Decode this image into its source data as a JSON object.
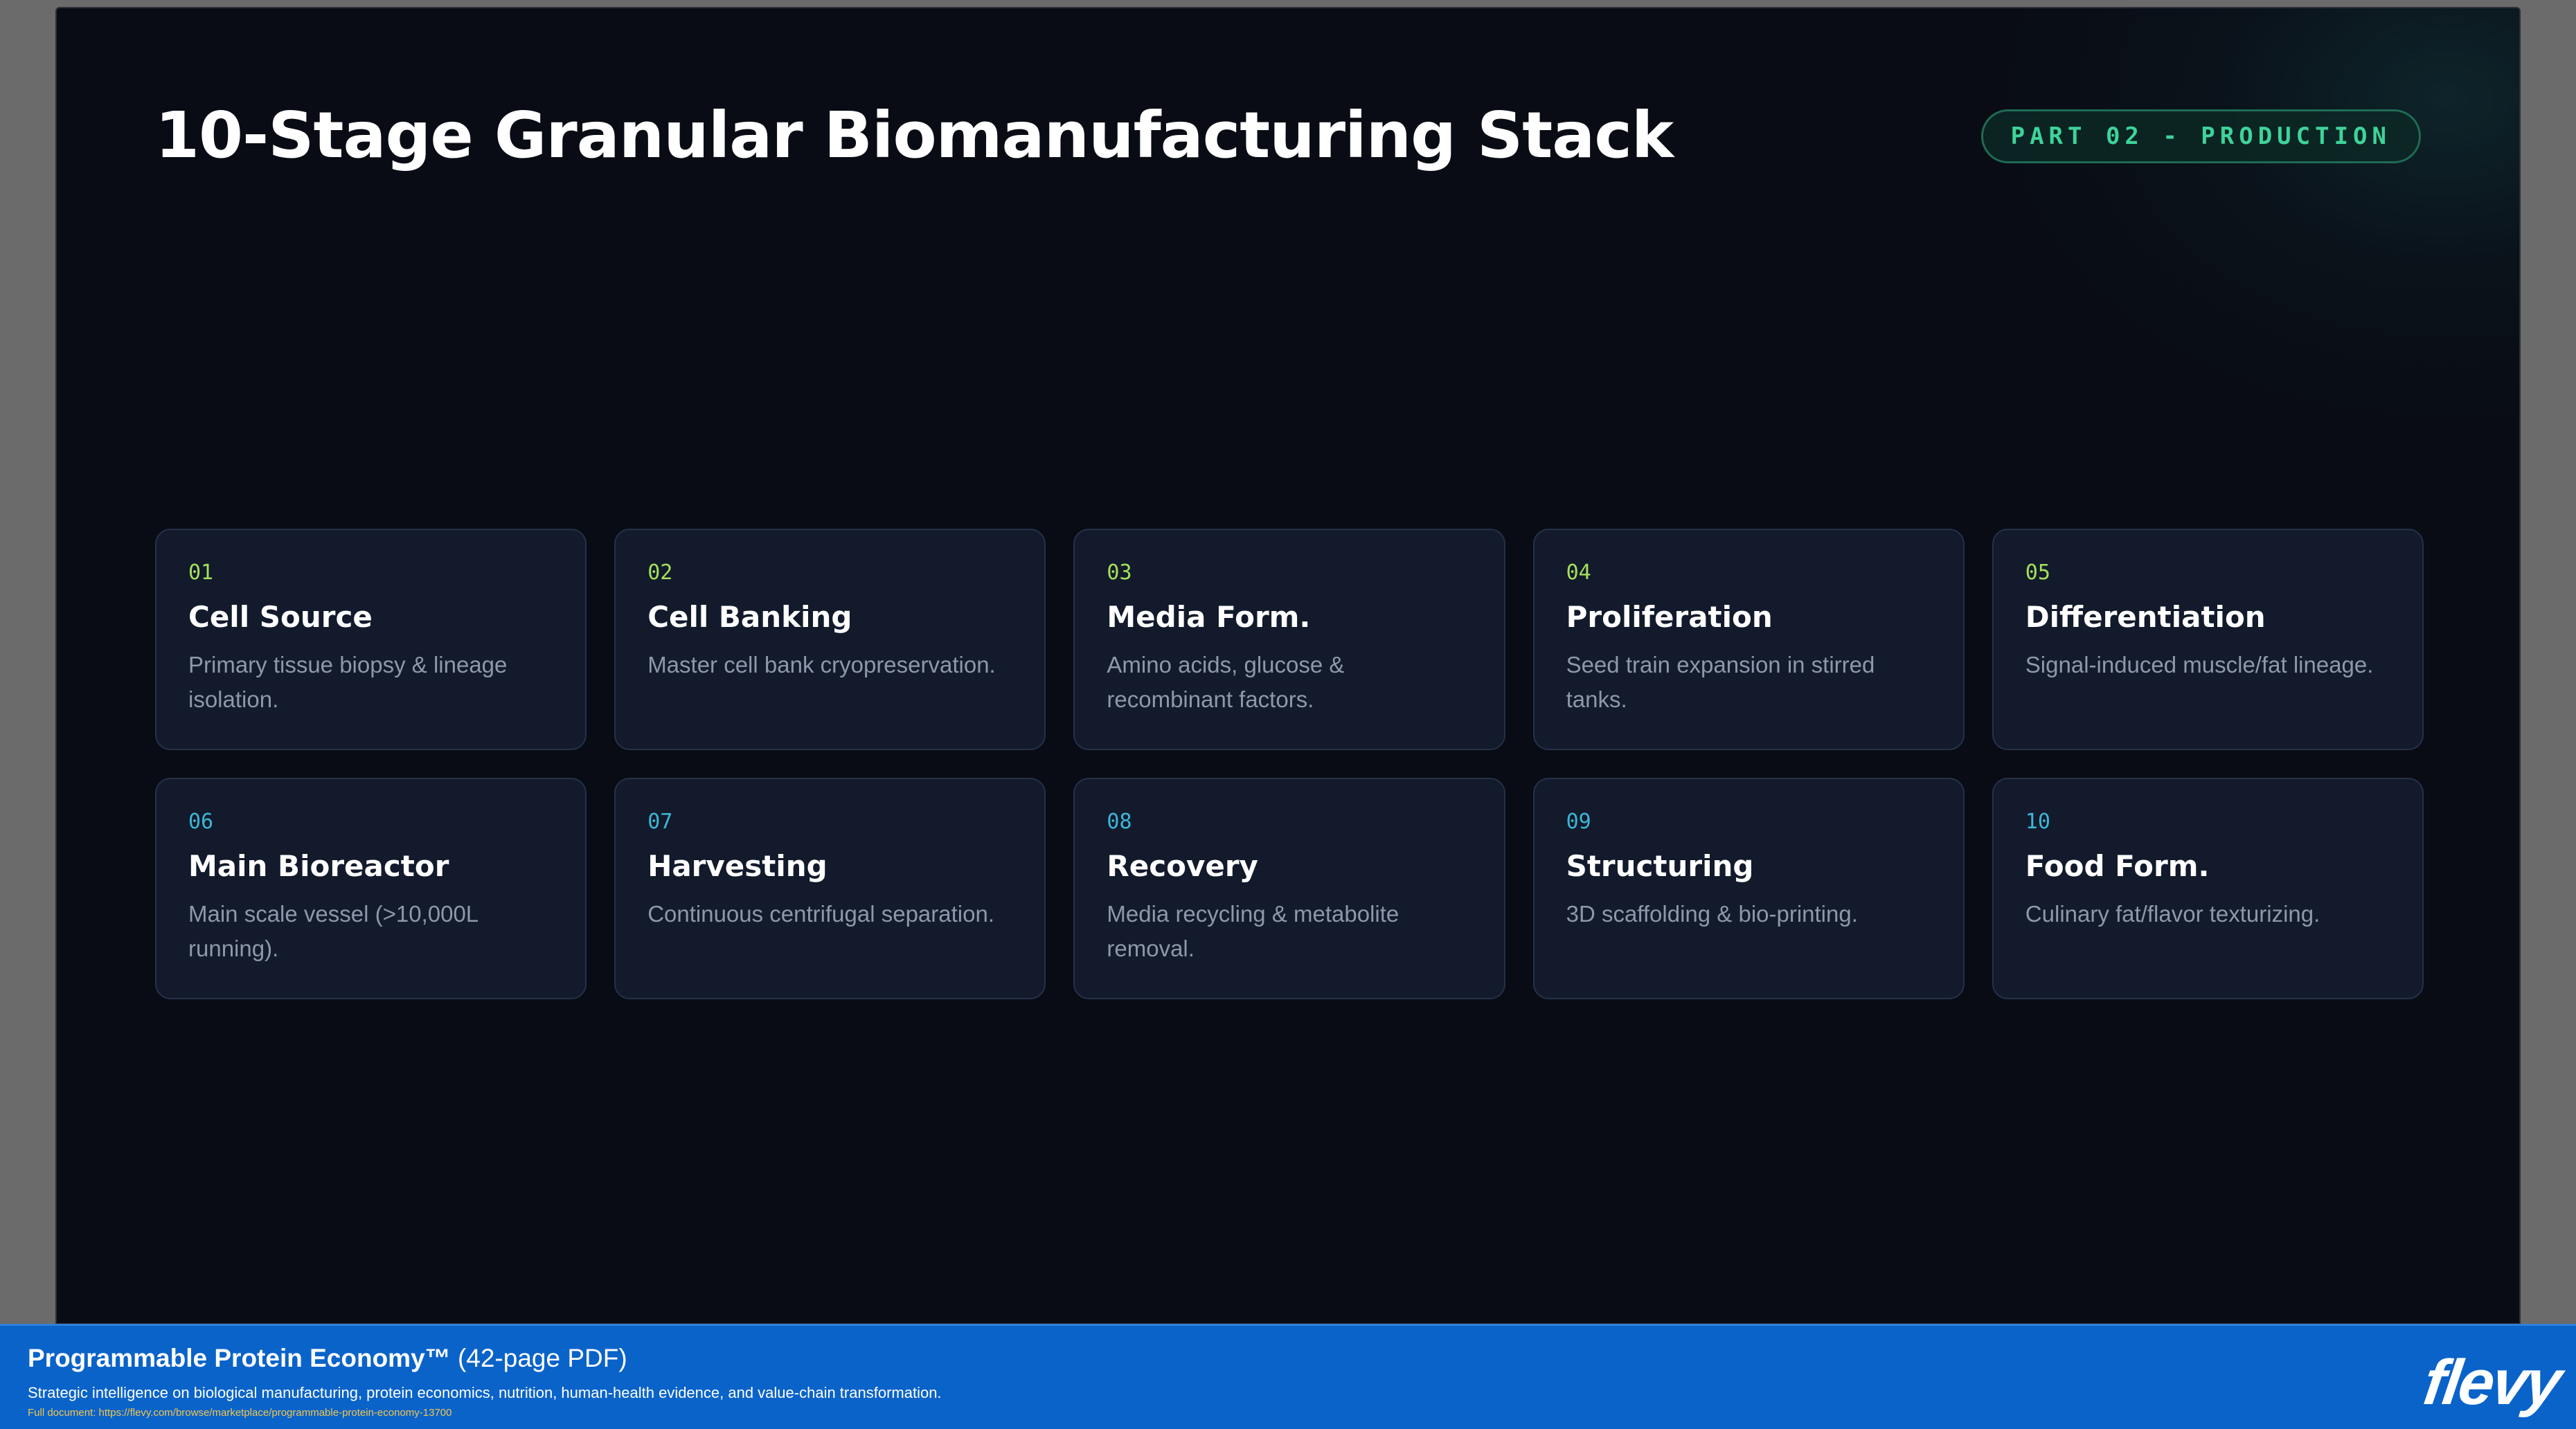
{
  "slide": {
    "title": "10-Stage Granular Biomanufacturing Stack",
    "badge": "PART 02 - PRODUCTION",
    "stages": [
      {
        "num": "01",
        "title": "Cell Source",
        "desc": "Primary tissue biopsy & lineage isolation."
      },
      {
        "num": "02",
        "title": "Cell Banking",
        "desc": "Master cell bank cryopreservation."
      },
      {
        "num": "03",
        "title": "Media Form.",
        "desc": "Amino acids, glucose & recombinant factors."
      },
      {
        "num": "04",
        "title": "Proliferation",
        "desc": "Seed train expansion in stirred tanks."
      },
      {
        "num": "05",
        "title": "Differentiation",
        "desc": "Signal-induced muscle/fat lineage."
      },
      {
        "num": "06",
        "title": "Main Bioreactor",
        "desc": "Main scale vessel (>10,000L running)."
      },
      {
        "num": "07",
        "title": "Harvesting",
        "desc": "Continuous centrifugal separation."
      },
      {
        "num": "08",
        "title": "Recovery",
        "desc": "Media recycling & metabolite removal."
      },
      {
        "num": "09",
        "title": "Structuring",
        "desc": "3D scaffolding & bio-printing."
      },
      {
        "num": "10",
        "title": "Food Form.",
        "desc": "Culinary fat/flavor texturizing."
      }
    ]
  },
  "footer": {
    "product_name": "Programmable Protein Economy™",
    "page_info": "(42-page PDF)",
    "subtitle": "Strategic intelligence on biological manufacturing, protein economics, nutrition, human-health evidence, and value-chain transformation.",
    "link": "Full document: https://flevy.com/browse/marketplace/programmable-protein-economy-13700",
    "brand": "flevy"
  },
  "colors": {
    "background": "#090c14",
    "card": "#121a2c",
    "accent_green": "#a5e05a",
    "accent_cyan": "#3cb7d6",
    "badge_text": "#3ed39a",
    "footer_bar": "#0a63c9"
  }
}
